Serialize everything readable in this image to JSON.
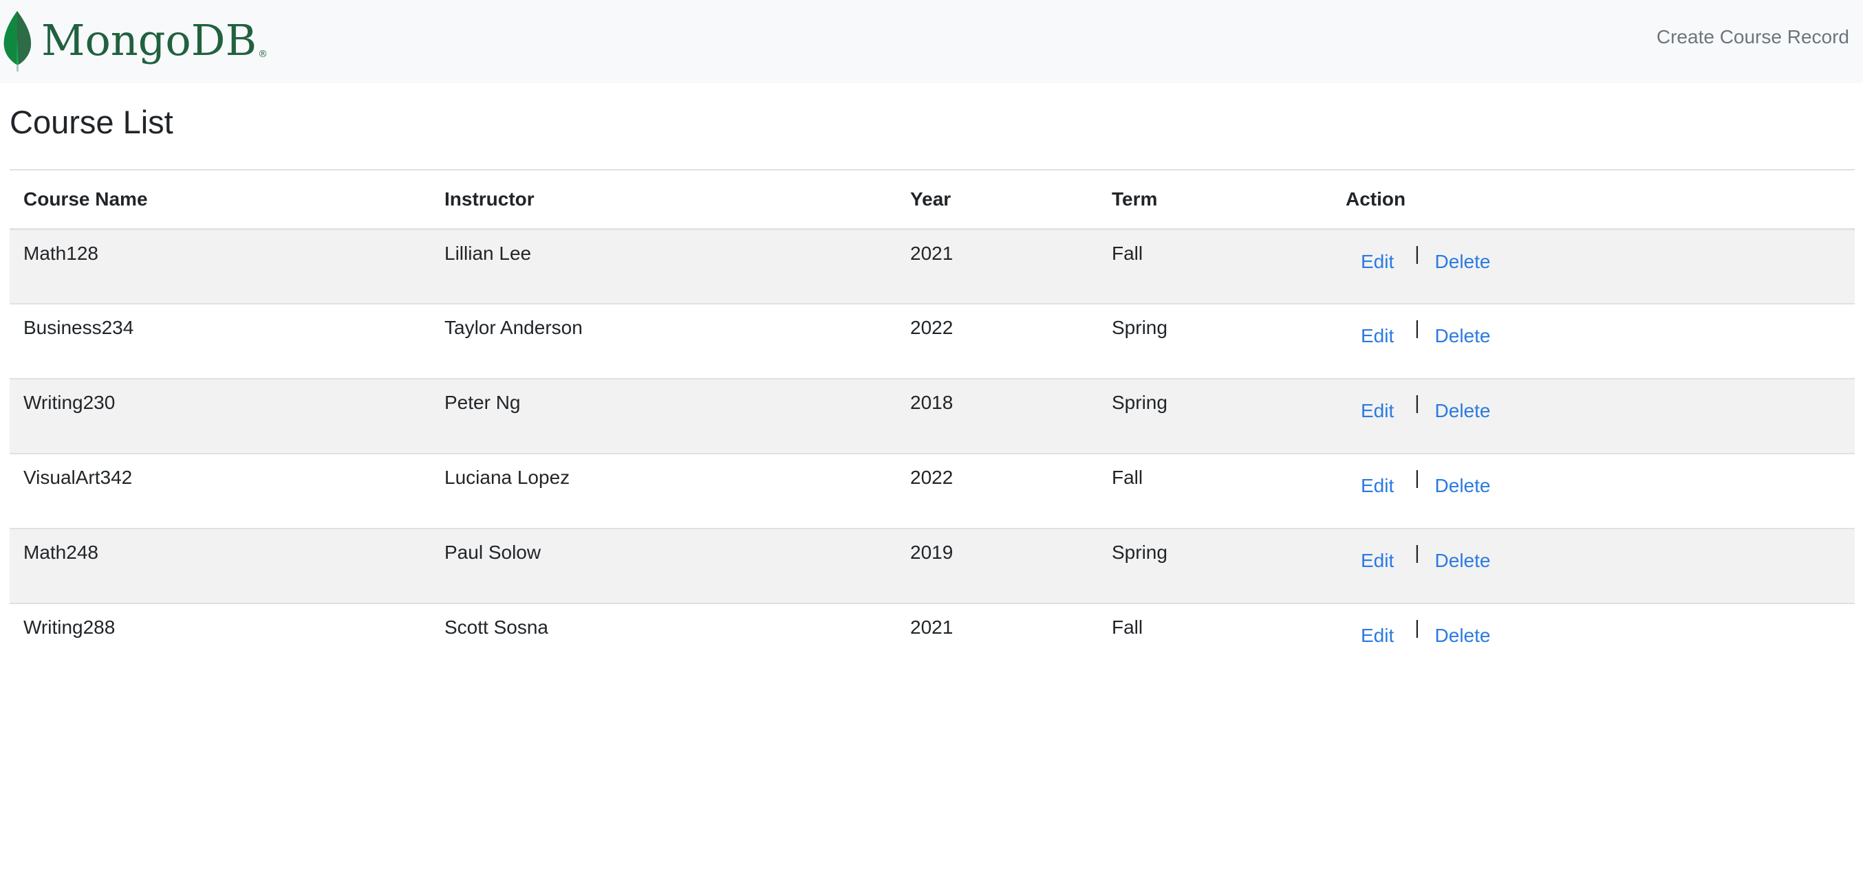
{
  "navbar": {
    "brand": "MongoDB",
    "brand_mark": "®",
    "create_link": "Create Course Record"
  },
  "main": {
    "title": "Course List"
  },
  "table": {
    "headers": [
      "Course Name",
      "Instructor",
      "Year",
      "Term",
      "Action"
    ],
    "action_edit": "Edit",
    "action_separator": "|",
    "action_delete": "Delete",
    "rows": [
      {
        "course": "Math128",
        "instructor": "Lillian Lee",
        "year": "2021",
        "term": "Fall"
      },
      {
        "course": "Business234",
        "instructor": "Taylor Anderson",
        "year": "2022",
        "term": "Spring"
      },
      {
        "course": "Writing230",
        "instructor": "Peter Ng",
        "year": "2018",
        "term": "Spring"
      },
      {
        "course": "VisualArt342",
        "instructor": "Luciana Lopez",
        "year": "2022",
        "term": "Fall"
      },
      {
        "course": "Math248",
        "instructor": "Paul Solow",
        "year": "2019",
        "term": "Spring"
      },
      {
        "course": "Writing288",
        "instructor": "Scott Sosna",
        "year": "2021",
        "term": "Fall"
      }
    ]
  },
  "icons": {
    "logo": "mongodb-leaf-icon"
  },
  "colors": {
    "brand_green": "#21613f",
    "link_blue": "#2a7ae2",
    "navbar_bg": "#f8f9fa",
    "stripe": "#f2f2f2"
  }
}
